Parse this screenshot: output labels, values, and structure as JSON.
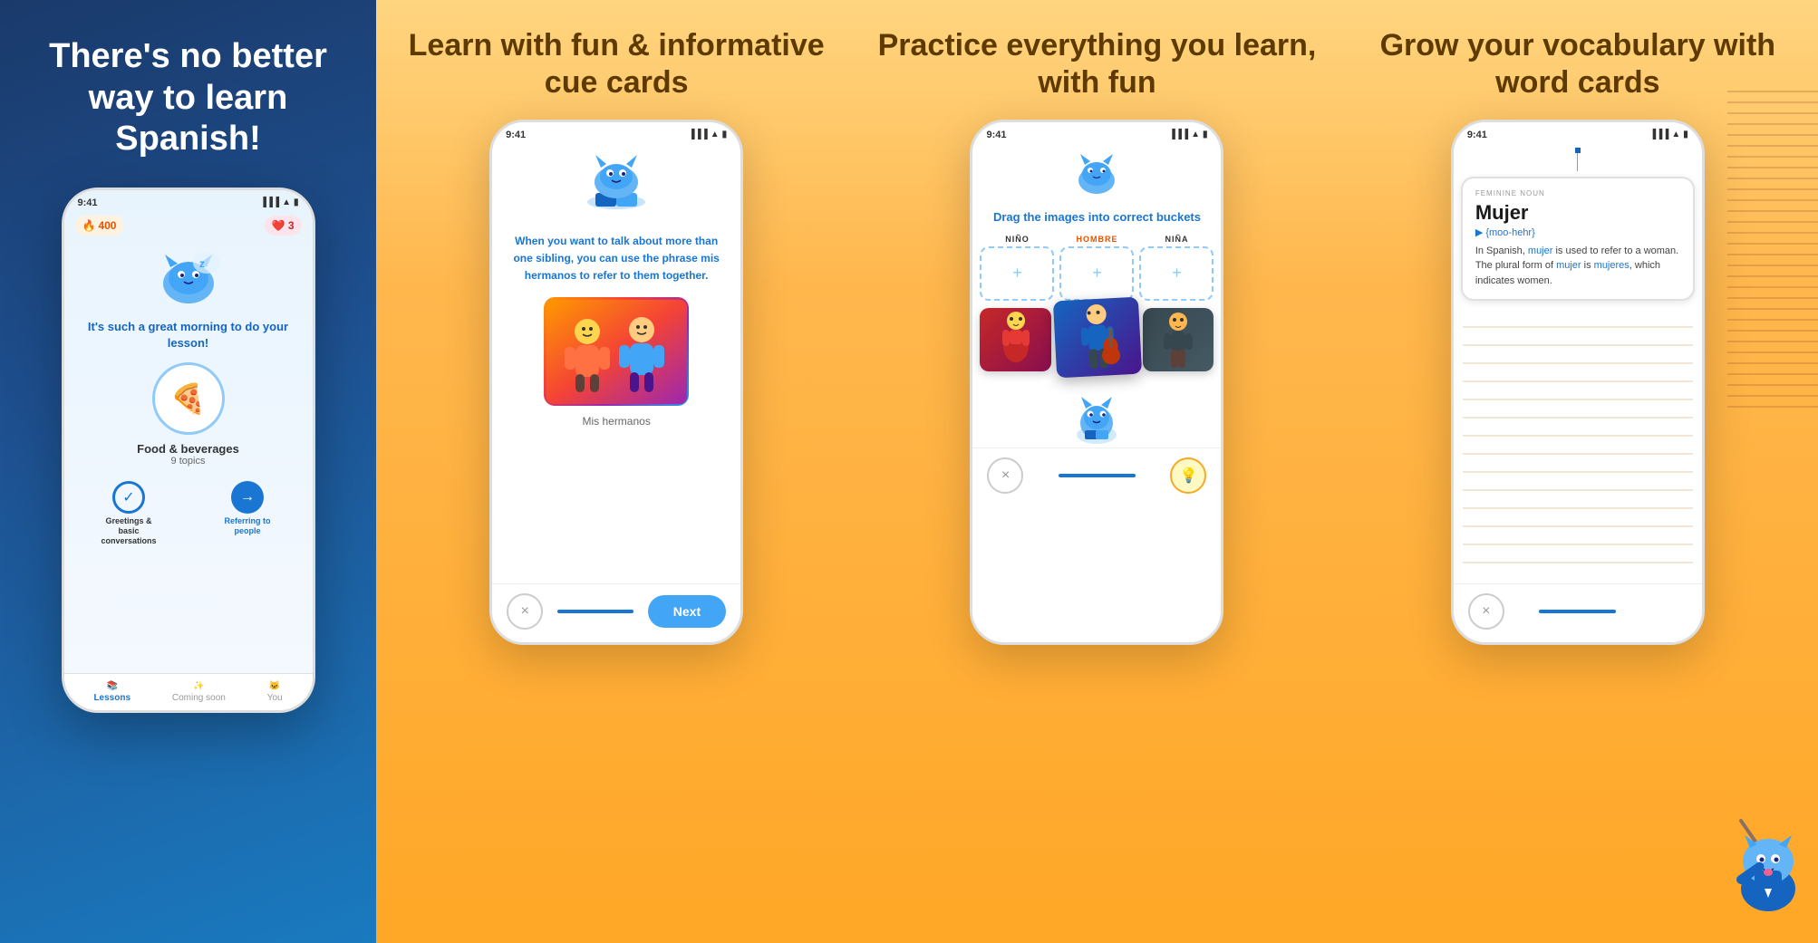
{
  "panel1": {
    "title": "There's no better way to learn Spanish!",
    "phone": {
      "time": "9:41",
      "streak": "400",
      "hearts": "3",
      "greeting": "It's such a great morning to do your lesson!",
      "food_category": "Food & beverages",
      "food_topics": "9 topics",
      "lesson1_label": "Greetings & basic conversations",
      "lesson2_label": "Referring to people",
      "nav_lessons": "Lessons",
      "nav_coming": "Coming soon",
      "nav_you": "You"
    }
  },
  "panel2": {
    "title": "Learn with fun & informative cue cards",
    "phone": {
      "time": "9:41",
      "body_text": "When you want to talk about more than one sibling, you can use the phrase",
      "highlighted_word": "mis hermanos",
      "body_text2": "to refer to them together.",
      "image_caption": "Mis hermanos",
      "btn_close": "×",
      "btn_next": "Next"
    }
  },
  "panel3": {
    "title": "Practice everything you learn, with fun",
    "phone": {
      "time": "9:41",
      "drag_title": "Drag the images into correct buckets",
      "bucket1_label": "NIÑO",
      "bucket2_label": "HOMBRE",
      "bucket3_label": "NIÑA",
      "btn_close": "×",
      "btn_hint": "💡"
    }
  },
  "panel4": {
    "title": "Grow your vocabulary with word cards",
    "phone": {
      "time": "9:41",
      "word_type": "FEMININE NOUN",
      "word": "Mujer",
      "phonetic": "▶ {moo-hehr}",
      "body_text1": "In Spanish,",
      "word1": "mujer",
      "body_text2": "is used to refer to a woman. The plural form of",
      "word2": "mujer",
      "body_text3": "is",
      "word3": "mujeres",
      "body_text4": ", which indicates women.",
      "btn_close": "×"
    }
  }
}
